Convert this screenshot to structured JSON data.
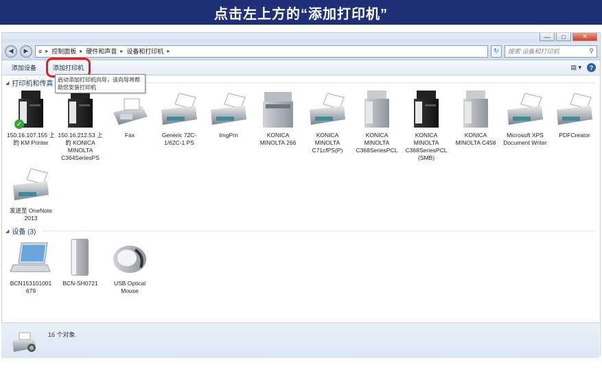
{
  "banner": {
    "text": "点击左上方的“添加打印机”"
  },
  "window": {
    "controls": {
      "minimize": "—",
      "maximize": "□",
      "close": "✕"
    },
    "nav": {
      "back": "◀",
      "forward": "▶"
    },
    "address": {
      "root": "≡",
      "crumbs": [
        "控制面板",
        "硬件和声音",
        "设备和打印机"
      ]
    },
    "refresh": "↻",
    "search_placeholder": "搜索 设备和打印机"
  },
  "toolbar": {
    "add_device": "添加设备",
    "add_printer": "添加打印机",
    "view_icon": "▤ ▾",
    "help": "?"
  },
  "tooltip": "启动添加打印机向导，该向导将帮助您安装打印机",
  "printers_group": {
    "title": "打印机和传真 (",
    "items": [
      {
        "label": "150.16.107.155 上的 KM Printer",
        "icon": "mfp-black-icon",
        "default": true
      },
      {
        "label": "150.16.212.53 上的 KONICA MINOLTA C364SeriesPS",
        "icon": "mfp-black-icon"
      },
      {
        "label": "Fax",
        "icon": "fax-icon"
      },
      {
        "label": "Generic 72C-1/62C-1 PS",
        "icon": "printer-icon"
      },
      {
        "label": "ImgPrn",
        "icon": "printer-icon"
      },
      {
        "label": "KONICA MINOLTA 266",
        "icon": "mfp-gray-icon"
      },
      {
        "label": "KONICA MINOLTA C71cfPS(P)",
        "icon": "printer-icon"
      },
      {
        "label": "KONICA MINOLTA C368SeriesPCL",
        "icon": "mfp-gray-icon"
      },
      {
        "label": "KONICA MINOLTA C368SeriesPCL (SMB)",
        "icon": "mfp-black-icon"
      },
      {
        "label": "KONICA MINOLTA C458",
        "icon": "mfp-gray-icon"
      },
      {
        "label": "Microsoft XPS Document Writer",
        "icon": "printer-icon"
      },
      {
        "label": "PDFCreator",
        "icon": "printer-icon"
      },
      {
        "label": "发送至 OneNote 2013",
        "icon": "printer-icon"
      }
    ]
  },
  "devices_group": {
    "title": "设备 (3)",
    "items": [
      {
        "label": "BCN153101001 679",
        "icon": "laptop-icon"
      },
      {
        "label": "BCN-SH0721",
        "icon": "external-drive-icon"
      },
      {
        "label": "USB Optical Mouse",
        "icon": "mouse-icon"
      }
    ]
  },
  "status": {
    "count_text": "16 个对象",
    "icon": "printer-camera-icon"
  },
  "colors": {
    "banner": "#1f2f78",
    "highlight": "#e01f1f",
    "link": "#1e3c78"
  }
}
